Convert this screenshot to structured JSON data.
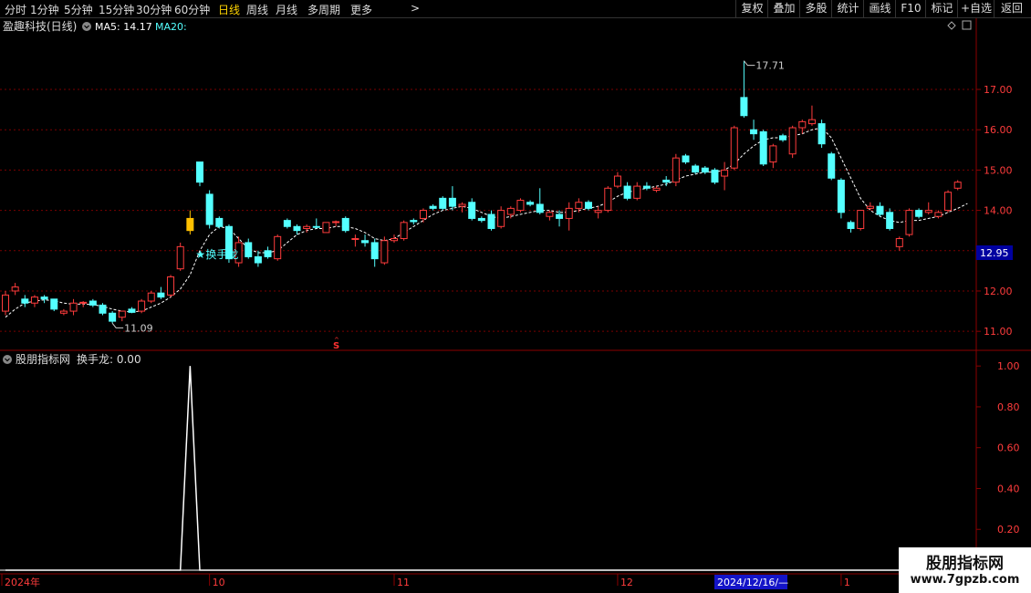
{
  "toolbar": {
    "periods": [
      {
        "label": "分时",
        "active": false
      },
      {
        "label": "1分钟",
        "active": false
      },
      {
        "label": "5分钟",
        "active": false
      },
      {
        "label": "15分钟",
        "active": false
      },
      {
        "label": "30分钟",
        "active": false
      },
      {
        "label": "60分钟",
        "active": false
      },
      {
        "label": "日线",
        "active": true
      },
      {
        "label": "周线",
        "active": false
      },
      {
        "label": "月线",
        "active": false
      },
      {
        "label": "多周期",
        "active": false
      },
      {
        "label": "更多",
        "active": false
      }
    ],
    "more_arrow": ">",
    "right_buttons": [
      "复权",
      "叠加",
      "多股",
      "统计",
      "画线",
      "F10",
      "标记",
      "+自选",
      "返回"
    ]
  },
  "price_panel": {
    "stock_label": "盈趣科技(日线)",
    "ma5_label": "MA5: 14.17",
    "ma20_label": "MA20:",
    "high_label": "17.71",
    "low_label": "11.09",
    "signal_label": "换手龙",
    "s_marker": "S",
    "current_price": "12.95"
  },
  "indicator_panel": {
    "title": "股朋指标网",
    "value_label": "换手龙: 0.00"
  },
  "time_axis": {
    "labels": [
      "2024年",
      "10",
      "11",
      "12",
      "1"
    ],
    "cursor_date": "2024/12/16/—"
  },
  "watermark": {
    "line1": "股朋指标网",
    "line2": "www.7gpzb.com"
  },
  "colors": {
    "up": "#ff3c3c",
    "down": "#54ffff",
    "highlight": "#ffc000",
    "ma5": "#ffffff",
    "ma20_label": "#54ffff",
    "grid": "#7a0000",
    "axis": "#8b0000",
    "active_period": "#ffd400",
    "price_box": "#0000a0"
  },
  "chart_data": [
    {
      "type": "candlestick",
      "title": "",
      "ylim": [
        10.8,
        18.2
      ],
      "y_ticks": [
        "11.00",
        "12.00",
        "13.00",
        "14.00",
        "15.00",
        "16.00",
        "17.00"
      ],
      "grid": true,
      "candles": [
        {
          "o": 11.5,
          "h": 12.0,
          "l": 11.4,
          "c": 11.9
        },
        {
          "o": 12.0,
          "h": 12.2,
          "l": 11.9,
          "c": 12.1
        },
        {
          "o": 11.8,
          "h": 11.9,
          "l": 11.6,
          "c": 11.7
        },
        {
          "o": 11.7,
          "h": 11.9,
          "l": 11.6,
          "c": 11.85
        },
        {
          "o": 11.85,
          "h": 11.9,
          "l": 11.7,
          "c": 11.8
        },
        {
          "o": 11.8,
          "h": 11.8,
          "l": 11.5,
          "c": 11.55
        },
        {
          "o": 11.45,
          "h": 11.55,
          "l": 11.4,
          "c": 11.5
        },
        {
          "o": 11.5,
          "h": 11.8,
          "l": 11.4,
          "c": 11.7
        },
        {
          "o": 11.7,
          "h": 11.75,
          "l": 11.6,
          "c": 11.72
        },
        {
          "o": 11.75,
          "h": 11.8,
          "l": 11.6,
          "c": 11.65
        },
        {
          "o": 11.65,
          "h": 11.7,
          "l": 11.4,
          "c": 11.45
        },
        {
          "o": 11.45,
          "h": 11.5,
          "l": 11.2,
          "c": 11.25
        },
        {
          "o": 11.35,
          "h": 11.5,
          "l": 11.25,
          "c": 11.5
        },
        {
          "o": 11.55,
          "h": 11.6,
          "l": 11.45,
          "c": 11.47
        },
        {
          "o": 11.5,
          "h": 11.8,
          "l": 11.45,
          "c": 11.75
        },
        {
          "o": 11.75,
          "h": 12.0,
          "l": 11.7,
          "c": 11.95
        },
        {
          "o": 11.95,
          "h": 12.1,
          "l": 11.8,
          "c": 11.85
        },
        {
          "o": 11.9,
          "h": 12.4,
          "l": 11.85,
          "c": 12.35
        },
        {
          "o": 12.55,
          "h": 13.2,
          "l": 12.5,
          "c": 13.1
        },
        {
          "o": 13.5,
          "h": 14.0,
          "l": 13.4,
          "c": 13.8
        },
        {
          "o": 15.2,
          "h": 15.2,
          "l": 14.6,
          "c": 14.7
        },
        {
          "o": 14.4,
          "h": 14.5,
          "l": 13.55,
          "c": 13.65
        },
        {
          "o": 13.8,
          "h": 13.85,
          "l": 13.55,
          "c": 13.6
        },
        {
          "o": 13.6,
          "h": 13.65,
          "l": 12.7,
          "c": 12.8
        },
        {
          "o": 12.7,
          "h": 13.35,
          "l": 12.6,
          "c": 13.2
        },
        {
          "o": 13.2,
          "h": 13.3,
          "l": 12.8,
          "c": 12.85
        },
        {
          "o": 12.85,
          "h": 13.0,
          "l": 12.6,
          "c": 12.7
        },
        {
          "o": 13.0,
          "h": 13.1,
          "l": 12.8,
          "c": 12.85
        },
        {
          "o": 12.8,
          "h": 13.4,
          "l": 12.75,
          "c": 13.35
        },
        {
          "o": 13.75,
          "h": 13.8,
          "l": 13.55,
          "c": 13.6
        },
        {
          "o": 13.6,
          "h": 13.65,
          "l": 13.4,
          "c": 13.5
        },
        {
          "o": 13.55,
          "h": 13.65,
          "l": 13.45,
          "c": 13.6
        },
        {
          "o": 13.6,
          "h": 13.8,
          "l": 13.55,
          "c": 13.58
        },
        {
          "o": 13.45,
          "h": 13.7,
          "l": 13.45,
          "c": 13.7
        },
        {
          "o": 13.7,
          "h": 13.75,
          "l": 13.6,
          "c": 13.72
        },
        {
          "o": 13.8,
          "h": 13.85,
          "l": 13.45,
          "c": 13.5
        },
        {
          "o": 13.3,
          "h": 13.4,
          "l": 13.1,
          "c": 13.3
        },
        {
          "o": 13.25,
          "h": 13.4,
          "l": 13.1,
          "c": 13.2
        },
        {
          "o": 13.2,
          "h": 13.3,
          "l": 12.6,
          "c": 12.8
        },
        {
          "o": 12.7,
          "h": 13.35,
          "l": 12.65,
          "c": 13.25
        },
        {
          "o": 13.25,
          "h": 13.4,
          "l": 13.2,
          "c": 13.3
        },
        {
          "o": 13.3,
          "h": 13.75,
          "l": 13.25,
          "c": 13.7
        },
        {
          "o": 13.75,
          "h": 13.8,
          "l": 13.65,
          "c": 13.72
        },
        {
          "o": 13.8,
          "h": 14.05,
          "l": 13.7,
          "c": 14.0
        },
        {
          "o": 14.1,
          "h": 14.15,
          "l": 14.0,
          "c": 14.05
        },
        {
          "o": 14.3,
          "h": 14.35,
          "l": 14.0,
          "c": 14.05
        },
        {
          "o": 14.3,
          "h": 14.6,
          "l": 14.0,
          "c": 14.1
        },
        {
          "o": 14.1,
          "h": 14.2,
          "l": 13.95,
          "c": 14.15
        },
        {
          "o": 14.2,
          "h": 14.3,
          "l": 13.75,
          "c": 13.8
        },
        {
          "o": 13.8,
          "h": 13.85,
          "l": 13.7,
          "c": 13.75
        },
        {
          "o": 13.9,
          "h": 14.0,
          "l": 13.5,
          "c": 13.55
        },
        {
          "o": 13.6,
          "h": 14.1,
          "l": 13.55,
          "c": 14.0
        },
        {
          "o": 13.9,
          "h": 14.1,
          "l": 13.8,
          "c": 14.05
        },
        {
          "o": 14.0,
          "h": 14.3,
          "l": 13.95,
          "c": 14.25
        },
        {
          "o": 14.2,
          "h": 14.25,
          "l": 14.1,
          "c": 14.15
        },
        {
          "o": 14.15,
          "h": 14.55,
          "l": 13.9,
          "c": 13.95
        },
        {
          "o": 13.85,
          "h": 14.0,
          "l": 13.75,
          "c": 13.95
        },
        {
          "o": 13.9,
          "h": 14.0,
          "l": 13.6,
          "c": 13.8
        },
        {
          "o": 13.8,
          "h": 14.2,
          "l": 13.5,
          "c": 14.05
        },
        {
          "o": 14.05,
          "h": 14.3,
          "l": 13.95,
          "c": 14.2
        },
        {
          "o": 14.2,
          "h": 14.25,
          "l": 14.0,
          "c": 14.05
        },
        {
          "o": 13.95,
          "h": 14.1,
          "l": 13.8,
          "c": 14.0
        },
        {
          "o": 14.0,
          "h": 14.6,
          "l": 13.95,
          "c": 14.55
        },
        {
          "o": 14.6,
          "h": 14.95,
          "l": 14.55,
          "c": 14.85
        },
        {
          "o": 14.6,
          "h": 14.7,
          "l": 14.25,
          "c": 14.3
        },
        {
          "o": 14.3,
          "h": 14.7,
          "l": 14.25,
          "c": 14.6
        },
        {
          "o": 14.6,
          "h": 14.7,
          "l": 14.5,
          "c": 14.55
        },
        {
          "o": 14.5,
          "h": 14.6,
          "l": 14.45,
          "c": 14.55
        },
        {
          "o": 14.75,
          "h": 14.85,
          "l": 14.6,
          "c": 14.7
        },
        {
          "o": 14.7,
          "h": 15.4,
          "l": 14.6,
          "c": 15.3
        },
        {
          "o": 15.35,
          "h": 15.4,
          "l": 15.15,
          "c": 15.2
        },
        {
          "o": 15.1,
          "h": 15.15,
          "l": 14.9,
          "c": 14.95
        },
        {
          "o": 15.05,
          "h": 15.1,
          "l": 14.9,
          "c": 14.95
        },
        {
          "o": 15.0,
          "h": 15.05,
          "l": 14.65,
          "c": 14.7
        },
        {
          "o": 14.85,
          "h": 15.2,
          "l": 14.5,
          "c": 15.0
        },
        {
          "o": 15.05,
          "h": 16.1,
          "l": 15.0,
          "c": 16.05
        },
        {
          "o": 16.8,
          "h": 17.71,
          "l": 16.3,
          "c": 16.35
        },
        {
          "o": 16.0,
          "h": 16.25,
          "l": 15.75,
          "c": 15.9
        },
        {
          "o": 15.95,
          "h": 16.0,
          "l": 15.1,
          "c": 15.15
        },
        {
          "o": 15.2,
          "h": 15.65,
          "l": 15.05,
          "c": 15.6
        },
        {
          "o": 15.85,
          "h": 15.9,
          "l": 15.7,
          "c": 15.75
        },
        {
          "o": 15.4,
          "h": 16.1,
          "l": 15.3,
          "c": 16.05
        },
        {
          "o": 16.05,
          "h": 16.25,
          "l": 15.9,
          "c": 16.2
        },
        {
          "o": 16.15,
          "h": 16.6,
          "l": 16.1,
          "c": 16.25
        },
        {
          "o": 16.15,
          "h": 16.25,
          "l": 15.55,
          "c": 15.65
        },
        {
          "o": 15.4,
          "h": 15.45,
          "l": 14.75,
          "c": 14.8
        },
        {
          "o": 14.75,
          "h": 14.8,
          "l": 13.8,
          "c": 13.95
        },
        {
          "o": 13.7,
          "h": 13.75,
          "l": 13.45,
          "c": 13.55
        },
        {
          "o": 13.55,
          "h": 14.0,
          "l": 13.5,
          "c": 14.0
        },
        {
          "o": 14.05,
          "h": 14.2,
          "l": 14.0,
          "c": 14.1
        },
        {
          "o": 14.1,
          "h": 14.2,
          "l": 13.85,
          "c": 13.9
        },
        {
          "o": 13.95,
          "h": 14.05,
          "l": 13.5,
          "c": 13.55
        },
        {
          "o": 13.1,
          "h": 13.35,
          "l": 13.0,
          "c": 13.3
        },
        {
          "o": 13.4,
          "h": 14.05,
          "l": 13.35,
          "c": 14.0
        },
        {
          "o": 14.0,
          "h": 14.05,
          "l": 13.8,
          "c": 13.85
        },
        {
          "o": 13.95,
          "h": 14.2,
          "l": 13.9,
          "c": 14.0
        },
        {
          "o": 13.85,
          "h": 14.0,
          "l": 13.8,
          "c": 13.95
        },
        {
          "o": 14.0,
          "h": 14.5,
          "l": 13.95,
          "c": 14.45
        },
        {
          "o": 14.55,
          "h": 14.75,
          "l": 14.5,
          "c": 14.7
        }
      ],
      "highlight_index": 19,
      "ma5": [
        11.35,
        11.55,
        11.7,
        11.75,
        11.78,
        11.76,
        11.7,
        11.67,
        11.68,
        11.66,
        11.62,
        11.55,
        11.5,
        11.48,
        11.5,
        11.6,
        11.7,
        11.85,
        12.05,
        12.4,
        13.0,
        13.4,
        13.6,
        13.55,
        13.3,
        13.05,
        12.95,
        12.95,
        13.0,
        13.2,
        13.4,
        13.5,
        13.55,
        13.55,
        13.6,
        13.6,
        13.55,
        13.45,
        13.3,
        13.25,
        13.3,
        13.45,
        13.6,
        13.75,
        13.9,
        14.0,
        14.05,
        14.1,
        14.05,
        13.95,
        13.85,
        13.8,
        13.85,
        13.9,
        13.95,
        14.0,
        14.0,
        13.95,
        13.95,
        14.0,
        14.05,
        14.1,
        14.2,
        14.35,
        14.45,
        14.5,
        14.55,
        14.6,
        14.65,
        14.75,
        14.85,
        14.9,
        14.95,
        14.95,
        15.0,
        15.15,
        15.4,
        15.6,
        15.75,
        15.8,
        15.8,
        15.85,
        15.9,
        16.0,
        16.05,
        15.8,
        15.3,
        14.8,
        14.3,
        14.0,
        13.85,
        13.75,
        13.7,
        13.75,
        13.75,
        13.8,
        13.85,
        13.95,
        14.05,
        14.17
      ]
    },
    {
      "type": "line",
      "title": "",
      "series_name": "换手龙",
      "ylim": [
        0,
        1.05
      ],
      "y_ticks": [
        "0.20",
        "0.40",
        "0.60",
        "0.80",
        "1.00"
      ],
      "grid": false,
      "values_note_index_of_peak": 19,
      "values": [
        0,
        0,
        0,
        0,
        0,
        0,
        0,
        0,
        0,
        0,
        0,
        0,
        0,
        0,
        0,
        0,
        0,
        0,
        0,
        1,
        0,
        0,
        0,
        0,
        0,
        0,
        0,
        0,
        0,
        0,
        0,
        0,
        0,
        0,
        0,
        0,
        0,
        0,
        0,
        0,
        0,
        0,
        0,
        0,
        0,
        0,
        0,
        0,
        0,
        0,
        0,
        0,
        0,
        0,
        0,
        0,
        0,
        0,
        0,
        0,
        0,
        0,
        0,
        0,
        0,
        0,
        0,
        0,
        0,
        0,
        0,
        0,
        0,
        0,
        0,
        0,
        0,
        0,
        0,
        0,
        0,
        0,
        0,
        0,
        0,
        0,
        0,
        0,
        0,
        0,
        0,
        0,
        0,
        0,
        0,
        0,
        0,
        0,
        0,
        0
      ]
    }
  ]
}
